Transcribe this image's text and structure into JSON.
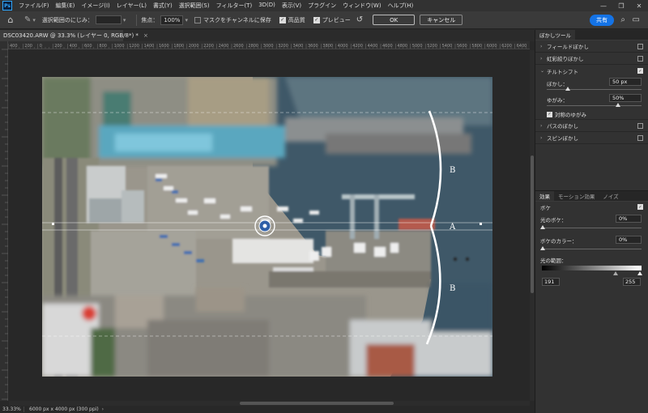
{
  "menu": {
    "logo": "Ps",
    "items": [
      "ファイル(F)",
      "編集(E)",
      "イメージ(I)",
      "レイヤー(L)",
      "書式(Y)",
      "選択範囲(S)",
      "フィルター(T)",
      "3D(D)",
      "表示(V)",
      "プラグイン",
      "ウィンドウ(W)",
      "ヘルプ(H)"
    ],
    "window_controls": [
      "—",
      "❐",
      "✕"
    ]
  },
  "options": {
    "home_icon": "home-icon",
    "selection_blur_label": "選択範囲のにじみ：",
    "focus_label": "焦点：",
    "focus_value": "100%",
    "mask_label": "マスクをチャンネルに保存",
    "mask_checked": false,
    "hq_label": "高品質",
    "hq_checked": true,
    "preview_label": "プレビュー",
    "preview_checked": true,
    "ok_label": "OK",
    "cancel_label": "キャンセル",
    "share_label": "共有",
    "search_icon": "search-icon",
    "workspace_icon": "workspace-icon"
  },
  "document": {
    "tab_title": "DSC03420.ARW @ 33.3% (レイヤー 0, RGB/8*) *",
    "close": "×"
  },
  "ruler": {
    "top_ticks": [
      "400",
      "200",
      "0",
      "200",
      "400",
      "600",
      "800",
      "1000",
      "1200",
      "1400",
      "1600",
      "1800",
      "2000",
      "2200",
      "2400",
      "2600",
      "2800",
      "3000",
      "3200",
      "3400",
      "3600",
      "3800",
      "4000",
      "4200",
      "4400",
      "4600",
      "4800",
      "5000",
      "5200",
      "5400",
      "5600",
      "5800",
      "6000",
      "6200",
      "6400"
    ]
  },
  "overlay": {
    "label_top": "B",
    "label_mid": "A",
    "label_bottom": "B"
  },
  "status": {
    "zoom": "33.33%",
    "info": "6000 px x 4000 px (300 ppi)",
    "arrow": "›"
  },
  "panel": {
    "tab_blur_tools": "ぼかしツール",
    "field_blur": "フィールドぼかし",
    "iris_blur": "虹彩絞りぼかし",
    "tilt_shift": "チルトシフト",
    "blur_label": "ぼかし：",
    "blur_value": "50 px",
    "blur_fraction": 0.22,
    "distortion_label": "ゆがみ：",
    "distortion_value": "50%",
    "distortion_fraction": 0.75,
    "symmetric_label": "対称のゆがみ",
    "path_blur": "パスのぼかし",
    "spin_blur": "スピンぼかし",
    "tabs_bottom": [
      "効果",
      "モーション効果",
      "ノイズ"
    ],
    "bokeh_label": "ボケ",
    "light_bokeh_label": "光のボケ：",
    "light_bokeh_value": "0%",
    "bokeh_color_label": "ボケのカラー：",
    "bokeh_color_value": "0%",
    "light_range_label": "光の範囲：",
    "range_low": "191",
    "range_high": "255"
  }
}
